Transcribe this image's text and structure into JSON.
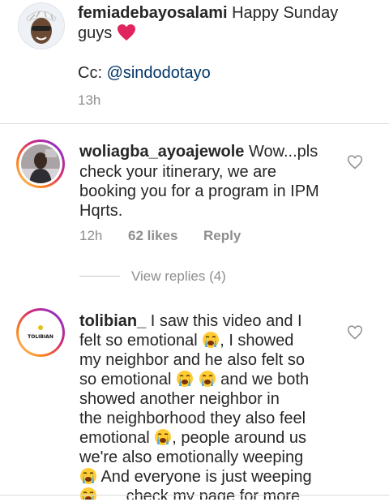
{
  "caption": {
    "username": "femiadebayosalami",
    "text_line1": "Happy Sunday",
    "text_line2": "guys",
    "cc_label": "Cc:",
    "mention": "@sindodotayo",
    "time": "13h"
  },
  "comments": [
    {
      "username": "woliagba_ayoajewole",
      "lines": [
        "Wow...pls",
        "check your itinerary, we are",
        "booking you for a program in IPM",
        "Hqrts."
      ],
      "time": "12h",
      "likes": "62 likes",
      "reply": "Reply"
    },
    {
      "username": "tolibian_",
      "avatar_text": "TOLIBIAN",
      "line1": "I saw this video and I",
      "line2a": "felt so emotional",
      "line2b": ", I showed",
      "line3": "my neighbor and he also felt so",
      "line4a": "so emotional",
      "line4b": "and we both",
      "line5": "showed another neighbor in",
      "line6": "the neighborhood they also feel",
      "line7a": "emotional",
      "line7b": ", people around  us",
      "line8": "we're also emotionally weeping",
      "line9": "And everyone is just weeping",
      "line10": "check my page for more"
    }
  ],
  "view_replies": "View replies (4)",
  "icons": {
    "like": "heart-outline-icon",
    "love": "red-heart-emoji",
    "cry": "loudly-crying-emoji"
  },
  "colors": {
    "text": "#262626",
    "secondary": "#8e8e8e",
    "mention": "#003569",
    "heart_red": "#e0245e"
  }
}
